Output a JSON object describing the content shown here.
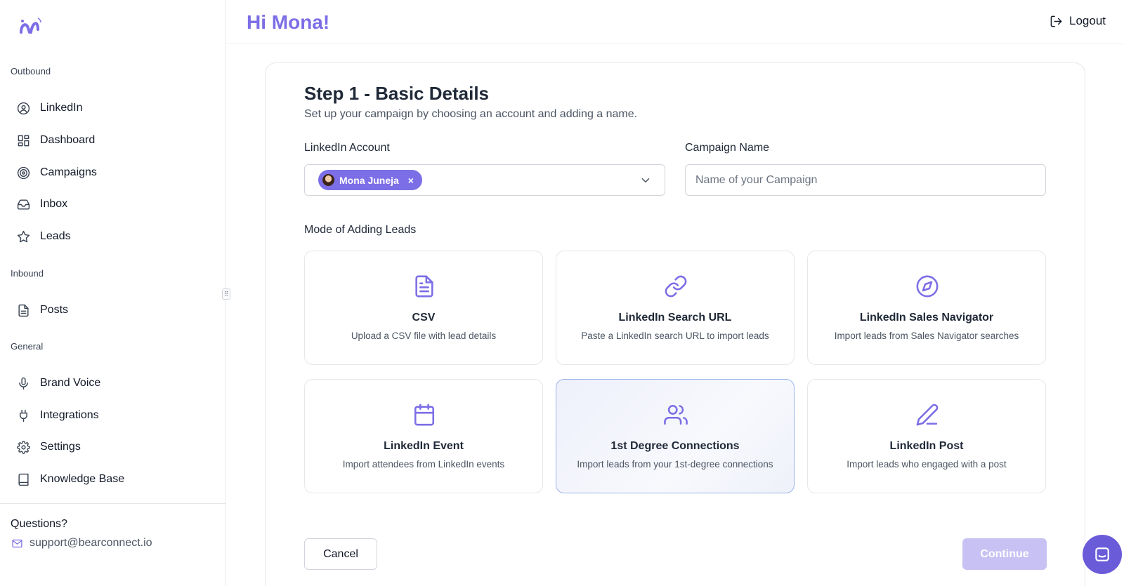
{
  "app": {
    "brand_color": "#7c6ee6"
  },
  "header": {
    "greeting": "Hi Mona!",
    "logout_label": "Logout"
  },
  "sidebar": {
    "sections": {
      "outbound": "Outbound",
      "inbound": "Inbound",
      "general": "General"
    },
    "items": [
      {
        "label": "LinkedIn",
        "icon": "user-circle-icon"
      },
      {
        "label": "Dashboard",
        "icon": "dashboard-grid-icon"
      },
      {
        "label": "Campaigns",
        "icon": "target-icon"
      },
      {
        "label": "Inbox",
        "icon": "inbox-icon"
      },
      {
        "label": "Leads",
        "icon": "star-icon"
      },
      {
        "label": "Posts",
        "icon": "document-icon"
      },
      {
        "label": "Brand Voice",
        "icon": "microphone-icon"
      },
      {
        "label": "Integrations",
        "icon": "plug-icon"
      },
      {
        "label": "Settings",
        "icon": "gear-icon"
      },
      {
        "label": "Knowledge Base",
        "icon": "book-icon"
      }
    ],
    "questions_label": "Questions?",
    "support_email": "support@bearconnect.io"
  },
  "form": {
    "title": "Step 1 - Basic Details",
    "subtitle": "Set up your campaign by choosing an account and adding a name.",
    "account_label": "LinkedIn Account",
    "account_selected": "Mona Juneja",
    "chip_remove": "×",
    "campaign_label": "Campaign Name",
    "campaign_value": "",
    "campaign_placeholder": "Name of your Campaign",
    "mode_label": "Mode of Adding Leads",
    "modes": [
      {
        "title": "CSV",
        "desc": "Upload a CSV file with lead details",
        "icon": "file-text-icon",
        "selected": false
      },
      {
        "title": "LinkedIn Search URL",
        "desc": "Paste a LinkedIn search URL to import leads",
        "icon": "link-icon",
        "selected": false
      },
      {
        "title": "LinkedIn Sales Navigator",
        "desc": "Import leads from Sales Navigator searches",
        "icon": "compass-icon",
        "selected": false
      },
      {
        "title": "LinkedIn Event",
        "desc": "Import attendees from LinkedIn events",
        "icon": "calendar-icon",
        "selected": false
      },
      {
        "title": "1st Degree Connections",
        "desc": "Import leads from your 1st-degree connections",
        "icon": "users-icon",
        "selected": true
      },
      {
        "title": "LinkedIn Post",
        "desc": "Import leads who engaged with a post",
        "icon": "pen-icon",
        "selected": false
      }
    ],
    "cancel_label": "Cancel",
    "continue_label": "Continue"
  }
}
